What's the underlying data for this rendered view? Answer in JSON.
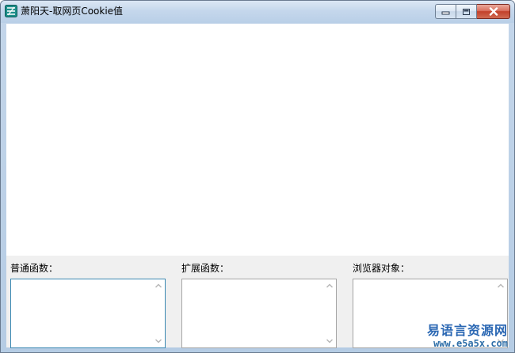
{
  "window": {
    "title": "萧阳天-取网页Cookie值"
  },
  "caption_buttons": {
    "minimize": "minimize",
    "maximize": "maximize",
    "close": "close"
  },
  "groups": {
    "normal_functions_label": "普通函数：",
    "extended_functions_label": "扩展函数：",
    "browser_objects_label": "浏览器对象："
  },
  "watermark": {
    "line1": "易语言资源网",
    "line2": "www.e5a5x.com"
  },
  "colors": {
    "title_gradient_top": "#dbe7f4",
    "close_button": "#c2402a",
    "client_bg": "#f0f0f0",
    "focused_border": "#3a88b2",
    "watermark": "#2a67b3"
  }
}
